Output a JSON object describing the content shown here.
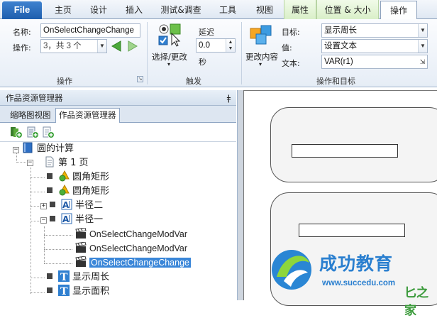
{
  "menu": {
    "file": "File",
    "tabs": [
      "主页",
      "设计",
      "插入",
      "测试&调查",
      "工具",
      "视图",
      "属性",
      "位置 & 大小",
      "操作"
    ]
  },
  "ribbon": {
    "name_label": "名称:",
    "name_value": "OnSelectChangeChange",
    "op_label": "操作:",
    "op_value": "3，共 3 个",
    "group1_label": "操作",
    "trigger_button": "选择/更改",
    "delay_label": "延迟",
    "delay_value": "0.0",
    "delay_unit": "秒",
    "group2_label": "触发",
    "change_content_button": "更改内容",
    "target_label": "目标:",
    "target_value": "显示周长",
    "value_label": "值:",
    "value_value": "设置文本",
    "text_label": "文本:",
    "text_value": "VAR(r1)",
    "group3_label": "操作和目标"
  },
  "pane": {
    "title": "作品资源管理器",
    "pin": "ǂ",
    "tabs": [
      "缩略图视图",
      "作品资源管理器"
    ]
  },
  "tree": {
    "root": "圆的计算",
    "page": "第 1 页",
    "items": [
      "圆角矩形",
      "圆角矩形",
      "半径二",
      "半径一",
      "OnSelectChangeModVar",
      "OnSelectChangeModVar",
      "OnSelectChangeChange",
      "显示周长",
      "显示面积"
    ]
  },
  "watermark": {
    "brand": "成功教育",
    "url": "www.succedu.com",
    "corner": "匕之家"
  },
  "colors": {
    "accent": "#3a86d8",
    "file_tab": "#2b6cbf",
    "contextual_tab": "#e3f3d6",
    "brand": "#2a7fcf"
  }
}
